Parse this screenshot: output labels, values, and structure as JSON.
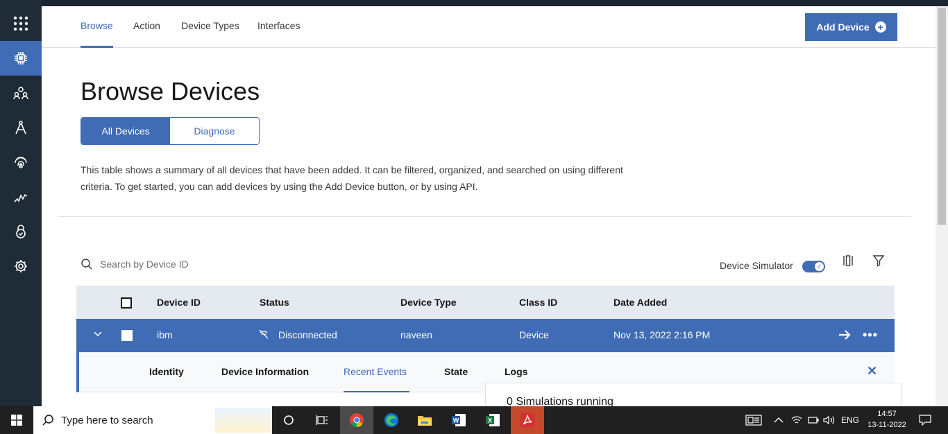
{
  "nav": {
    "tabs": [
      {
        "label": "Browse"
      },
      {
        "label": "Action"
      },
      {
        "label": "Device Types"
      },
      {
        "label": "Interfaces"
      }
    ],
    "add_device_label": "Add Device"
  },
  "page": {
    "title": "Browse Devices",
    "segments": [
      "All Devices",
      "Diagnose"
    ],
    "description_line1": "This table shows a summary of all devices that have been added. It can be filtered, organized, and searched on using different",
    "description_line2": "criteria. To get started, you can add devices by using the Add Device button, or by using API."
  },
  "toolbar": {
    "search_placeholder": "Search by Device ID",
    "simulator_label": "Device Simulator",
    "simulator_on": true
  },
  "table": {
    "columns": [
      "Device ID",
      "Status",
      "Device Type",
      "Class ID",
      "Date Added"
    ],
    "rows": [
      {
        "device_id": "ibm",
        "status": "Disconnected",
        "device_type": "naveen",
        "class_id": "Device",
        "date_added": "Nov 13, 2022 2:16 PM"
      }
    ]
  },
  "detail": {
    "tabs": [
      "Identity",
      "Device Information",
      "Recent Events",
      "State",
      "Logs"
    ],
    "active_tab": "Recent Events",
    "simulator_text": "0 Simulations running"
  },
  "taskbar": {
    "search_placeholder": "Type here to search",
    "language": "ENG",
    "time": "14:57",
    "date": "13-11-2022"
  },
  "colors": {
    "accent": "#3f6cb5",
    "sidebar": "#1f2b36",
    "taskbar": "#202020"
  }
}
